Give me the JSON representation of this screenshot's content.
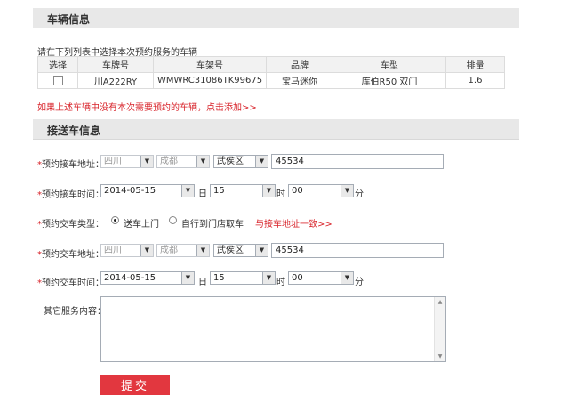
{
  "vehicle_section": {
    "title": "车辆信息",
    "hint": "请在下列列表中选择本次预约服务的车辆",
    "columns": [
      "选择",
      "车牌号",
      "车架号",
      "品牌",
      "车型",
      "排量"
    ],
    "rows": [
      {
        "plate": "川A222RY",
        "vin": "WMWRC31086TK99675",
        "brand": "宝马迷你",
        "model": "库伯R50 双门",
        "displacement": "1.6"
      }
    ],
    "add_link": "如果上述车辆中没有本次需要预约的车辆，点击添加>>"
  },
  "pickup_section": {
    "title": "接送车信息",
    "pickup_address": {
      "label": "预约接车地址：",
      "province": "四川",
      "city": "成都",
      "district": "武侯区",
      "detail": "45534"
    },
    "pickup_time": {
      "label": "预约接车时间：",
      "date": "2014-05-15",
      "day_unit": "日",
      "hour": "15",
      "hour_unit": "时",
      "minute": "00",
      "minute_unit": "分"
    },
    "delivery_type": {
      "label": "预约交车类型：",
      "option1": "送车上门",
      "option2": "自行到门店取车",
      "same_link": "与接车地址一致>>"
    },
    "delivery_address": {
      "label": "预约交车地址：",
      "province": "四川",
      "city": "成都",
      "district": "武侯区",
      "detail": "45534"
    },
    "delivery_time": {
      "label": "预约交车时间：",
      "date": "2014-05-15",
      "day_unit": "日",
      "hour": "15",
      "hour_unit": "时",
      "minute": "00",
      "minute_unit": "分"
    },
    "other_label": "其它服务内容：",
    "submit": "提交"
  },
  "icons": {
    "dropdown": "dropdown-arrow-icon",
    "scroll_up": "scroll-up-icon",
    "scroll_down": "scroll-down-icon"
  },
  "colors": {
    "accent_red": "#d8232a",
    "button_red": "#e2373f",
    "header_bg": "#e8e8e8"
  }
}
